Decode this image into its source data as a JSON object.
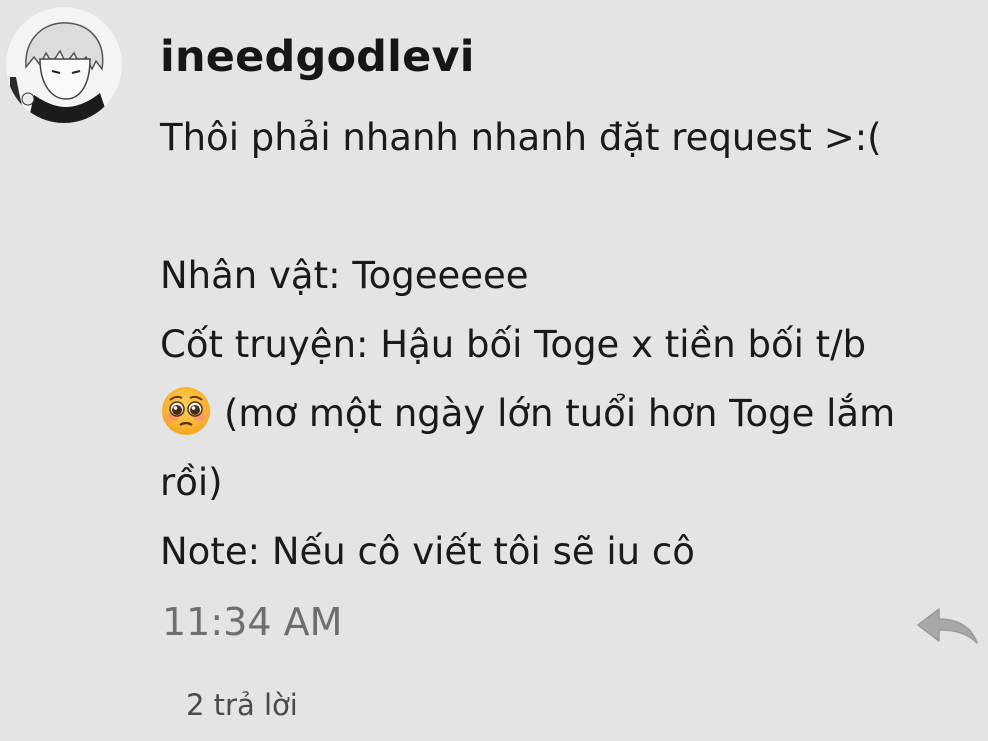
{
  "comment": {
    "username": "ineedgodlevi",
    "avatar_icon": "anime-character-avatar",
    "lines": [
      "Thôi phải nhanh nhanh đặt request >:(",
      "",
      "Nhân vật: Togeeeee",
      "Cốt truyện: Hậu bối Toge x tiền bối t/b",
      "(mơ một ngày lớn tuổi hơn Toge lắm",
      "rồi)",
      "Note: Nếu cô viết tôi sẽ iu cô"
    ],
    "emoji_icon": "pleading-face-emoji",
    "timestamp": "11:34 AM",
    "reply_icon": "reply-arrow-icon",
    "replies_link": "2 trả lời"
  },
  "colors": {
    "background": "#e4e4e4",
    "text": "#1a1a1a",
    "muted": "#6e6e6e",
    "icon": "#a8a8a8"
  }
}
